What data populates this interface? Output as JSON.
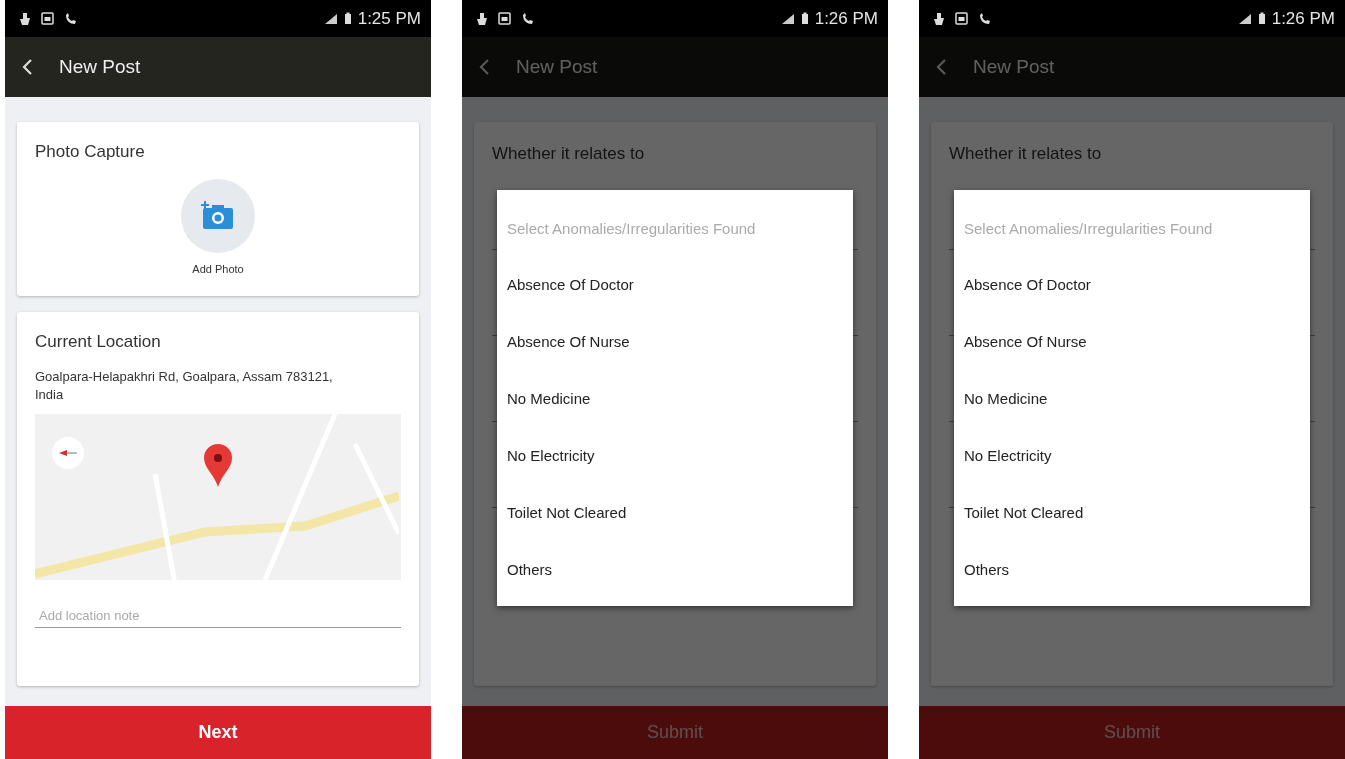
{
  "screens": [
    {
      "kind": "form",
      "dimmed": false,
      "status_bar": {
        "time": "1:25 PM"
      },
      "app_bar": {
        "title": "New Post"
      },
      "photo_card": {
        "title": "Photo Capture",
        "action": "Add Photo"
      },
      "location_card": {
        "title": "Current Location",
        "address": "Goalpara-Helapakhri Rd, Goalpara, Assam 783121, India",
        "note_placeholder": "Add location note"
      },
      "footer_button": {
        "label": "Next",
        "disabled": false
      }
    },
    {
      "kind": "dropdown",
      "dimmed": true,
      "status_bar": {
        "time": "1:26 PM"
      },
      "app_bar": {
        "title": "New Post"
      },
      "card_title": "Whether it relates to",
      "dropdown": {
        "placeholder": "Select Anomalies/Irregularities Found",
        "options": [
          "Absence Of Doctor",
          "Absence Of Nurse",
          "No Medicine",
          "No Electricity",
          "Toilet Not Cleared",
          "Others"
        ]
      },
      "footer_button": {
        "label": "Submit",
        "disabled": true
      }
    },
    {
      "kind": "dropdown",
      "dimmed": true,
      "status_bar": {
        "time": "1:26 PM"
      },
      "app_bar": {
        "title": "New Post"
      },
      "card_title": "Whether it relates to",
      "dropdown": {
        "placeholder": "Select Anomalies/Irregularities Found",
        "options": [
          "Absence Of Doctor",
          "Absence Of Nurse",
          "No Medicine",
          "No Electricity",
          "Toilet Not Cleared",
          "Others"
        ]
      },
      "footer_button": {
        "label": "Submit",
        "disabled": true
      }
    }
  ]
}
